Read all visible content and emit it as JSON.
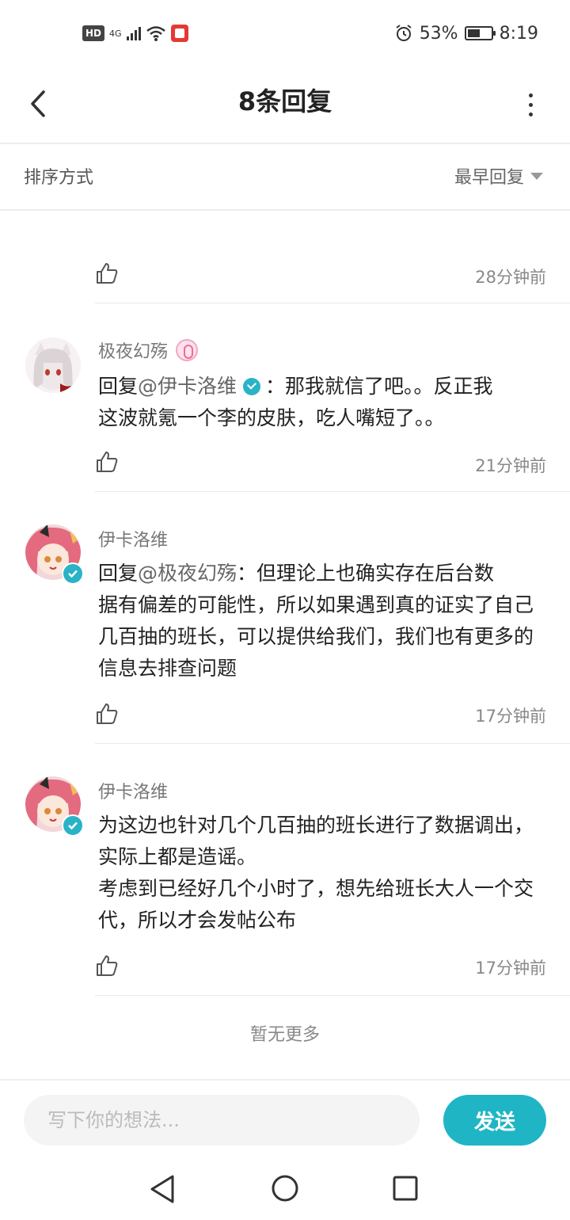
{
  "status_bar": {
    "hd": "HD",
    "network": "4G",
    "battery_percent": "53%",
    "time": "8:19"
  },
  "header": {
    "title": "8条回复"
  },
  "sort": {
    "label": "排序方式",
    "value": "最早回复"
  },
  "comments": [
    {
      "time": "28分钟前"
    },
    {
      "username": "极夜幻殇",
      "reply_prefix": "回复",
      "mention": "@伊卡洛维",
      "text_line1": "：那我就信了吧。。反正我",
      "text_line2": "这波就氪一个李的皮肤，吃人嘴短了。。",
      "time": "21分钟前"
    },
    {
      "username": "伊卡洛维",
      "reply_prefix": "回复",
      "mention": "@极夜幻殇",
      "text_line1": "：但理论上也确实存在后台数",
      "text_rest": "据有偏差的可能性，所以如果遇到真的证实了自己几百抽的班长，可以提供给我们，我们也有更多的信息去排查问题",
      "time": "17分钟前"
    },
    {
      "username": "伊卡洛维",
      "text": "为这边也针对几个几百抽的班长进行了数据调出，实际上都是造谣。\n考虑到已经好几个小时了，想先给班长大人一个交代，所以才会发帖公布",
      "time": "17分钟前"
    }
  ],
  "footer_note": "暂无更多",
  "input": {
    "placeholder": "写下你的想法...",
    "send_label": "发送"
  },
  "colors": {
    "accent": "#1fb5c5",
    "verified": "#2ab3c6",
    "muted_text": "#888888"
  }
}
